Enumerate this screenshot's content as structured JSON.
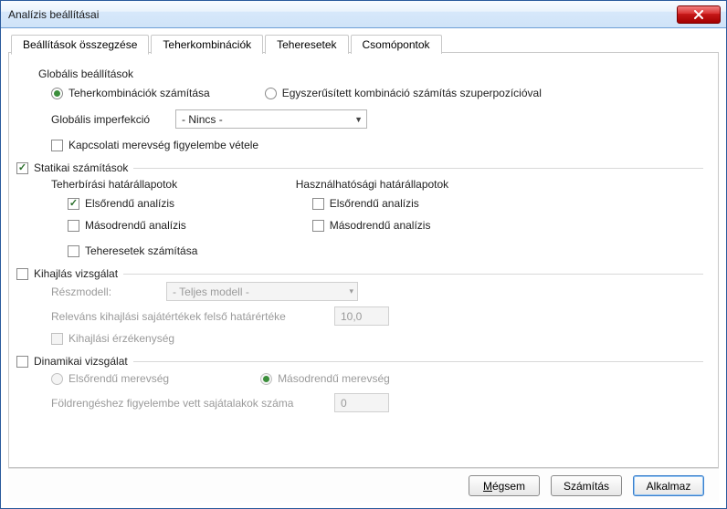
{
  "window": {
    "title": "Analízis beállításai"
  },
  "tabs": [
    {
      "label": "Beállítások összegzése",
      "active": true
    },
    {
      "label": "Teherkombinációk",
      "active": false
    },
    {
      "label": "Teheresetek",
      "active": false
    },
    {
      "label": "Csomópontok",
      "active": false
    }
  ],
  "global": {
    "title": "Globális beállítások",
    "calc_combos": "Teherkombinációk számítása",
    "simplified": "Egyszerűsített kombináció számítás szuperpozícióval",
    "imperfection_label": "Globális imperfekció",
    "imperfection_value": "- Nincs -",
    "joint_stiffness": "Kapcsolati merevség figyelembe vétele"
  },
  "static": {
    "title": "Statikai számítások",
    "uls_title": "Teherbírási határállapotok",
    "sls_title": "Használhatósági határállapotok",
    "first_order": "Elsőrendű analízis",
    "second_order": "Másodrendű analízis",
    "calc_loadcases": "Teheresetek számítása"
  },
  "buckling": {
    "title": "Kihajlás vizsgálat",
    "partmodel_label": "Részmodell:",
    "partmodel_value": "- Teljes modell -",
    "eigen_limit_label": "Releváns kihajlási sajátértékek felső határértéke",
    "eigen_limit_value": "10,0",
    "sensitivity": "Kihajlási érzékenység"
  },
  "dynamic": {
    "title": "Dinamikai vizsgálat",
    "first_stiff": "Elsőrendű merevség",
    "second_stiff": "Másodrendű merevség",
    "modes_label": "Földrengéshez figyelembe vett sajátalakok száma",
    "modes_value": "0"
  },
  "buttons": {
    "cancel": "Mégsem",
    "calc": "Számítás",
    "apply": "Alkalmaz"
  }
}
